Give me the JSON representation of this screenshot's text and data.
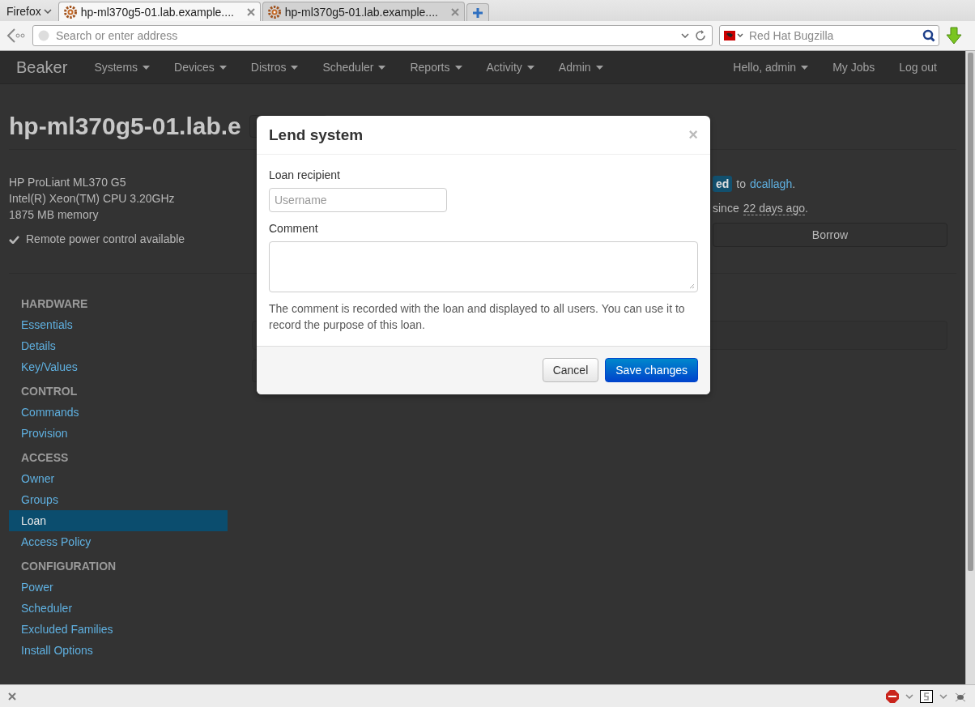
{
  "browser": {
    "menu": "Firefox",
    "tabs": [
      {
        "title": "hp-ml370g5-01.lab.example....",
        "selected": true
      },
      {
        "title": "hp-ml370g5-01.lab.example....",
        "selected": false
      }
    ],
    "address": {
      "placeholder": "Search or enter address"
    },
    "search": {
      "placeholder": "Red Hat Bugzilla"
    }
  },
  "navbar": {
    "brand": "Beaker",
    "menus": [
      {
        "label": "Systems",
        "dropdown": true
      },
      {
        "label": "Devices",
        "dropdown": true
      },
      {
        "label": "Distros",
        "dropdown": true
      },
      {
        "label": "Scheduler",
        "dropdown": true
      },
      {
        "label": "Reports",
        "dropdown": true
      },
      {
        "label": "Activity",
        "dropdown": true
      },
      {
        "label": "Admin",
        "dropdown": true
      }
    ],
    "right": [
      {
        "label": "Hello, admin",
        "dropdown": true
      },
      {
        "label": "My Jobs",
        "dropdown": false
      },
      {
        "label": "Log out",
        "dropdown": false
      }
    ]
  },
  "system": {
    "title": "hp-ml370g5-01.lab.e",
    "details": [
      "HP ProLiant ML370 G5",
      "Intel(R) Xeon(TM) CPU 3.20GHz",
      "1875 MB memory"
    ],
    "power": "Remote power control available",
    "status_badge": "ed",
    "status_to": "to",
    "status_user": "dcallagh",
    "status_end": ".",
    "since": "since",
    "since_time": "22 days ago",
    "since_end": ".",
    "borrow": "Borrow"
  },
  "sidebar": [
    {
      "heading": "HARDWARE",
      "items": [
        {
          "label": "Essentials",
          "selected": false
        },
        {
          "label": "Details",
          "selected": false
        },
        {
          "label": "Key/Values",
          "selected": false
        }
      ]
    },
    {
      "heading": "CONTROL",
      "items": [
        {
          "label": "Commands",
          "selected": false
        },
        {
          "label": "Provision",
          "selected": false
        }
      ]
    },
    {
      "heading": "ACCESS",
      "items": [
        {
          "label": "Owner",
          "selected": false
        },
        {
          "label": "Groups",
          "selected": false
        },
        {
          "label": "Loan",
          "selected": true
        },
        {
          "label": "Access Policy",
          "selected": false
        }
      ]
    },
    {
      "heading": "CONFIGURATION",
      "items": [
        {
          "label": "Power",
          "selected": false
        },
        {
          "label": "Scheduler",
          "selected": false
        },
        {
          "label": "Excluded Families",
          "selected": false
        },
        {
          "label": "Install Options",
          "selected": false
        }
      ]
    }
  ],
  "modal": {
    "title": "Lend system",
    "close": "×",
    "recipient_label": "Loan recipient",
    "recipient_placeholder": "Username",
    "comment_label": "Comment",
    "help": "The comment is recorded with the loan and displayed to all users. You can use it to record the purpose of this loan.",
    "buttons": [
      {
        "label": "Cancel",
        "kind": "default"
      },
      {
        "label": "Save changes",
        "kind": "primary"
      }
    ]
  }
}
